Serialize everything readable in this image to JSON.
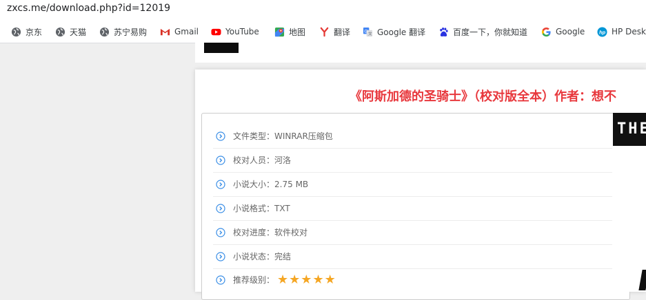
{
  "browser": {
    "url": "zxcs.me/download.php?id=12019",
    "bookmarks": [
      {
        "label": "京东",
        "icon": "globe-icon"
      },
      {
        "label": "天猫",
        "icon": "globe-icon"
      },
      {
        "label": "苏宁易购",
        "icon": "globe-icon"
      },
      {
        "label": "Gmail",
        "icon": "gmail-icon"
      },
      {
        "label": "YouTube",
        "icon": "youtube-icon"
      },
      {
        "label": "地图",
        "icon": "maps-icon"
      },
      {
        "label": "翻译",
        "icon": "yandex-translate-icon"
      },
      {
        "label": "Google 翻译",
        "icon": "google-translate-icon"
      },
      {
        "label": "百度一下，你就知道",
        "icon": "baidu-paw-icon"
      },
      {
        "label": "Google",
        "icon": "google-icon"
      },
      {
        "label": "HP Desk",
        "icon": "hp-icon"
      }
    ]
  },
  "page": {
    "title": "《阿斯加德的圣骑士》（校对版全本）作者：想不",
    "info": [
      {
        "key": "文件类型",
        "sep": "：",
        "value": "WINRAR压缩包"
      },
      {
        "key": "校对人员",
        "sep": "：",
        "value": "河洛"
      },
      {
        "key": "小说大小",
        "sep": "：",
        "value": "2.75 MB"
      },
      {
        "key": "小说格式",
        "sep": "：",
        "value": "TXT"
      },
      {
        "key": "校对进度",
        "sep": "：",
        "value": "软件校对"
      },
      {
        "key": "小说状态",
        "sep": "：",
        "value": "完结"
      },
      {
        "key": "推荐级别",
        "sep": "：",
        "value": "★★★★★",
        "rating": 5,
        "max": 5
      }
    ],
    "cover_text": "THE",
    "colors": {
      "title": "#e8383d",
      "stars": "#f5a623",
      "chevron": "#3a8ee6"
    }
  }
}
